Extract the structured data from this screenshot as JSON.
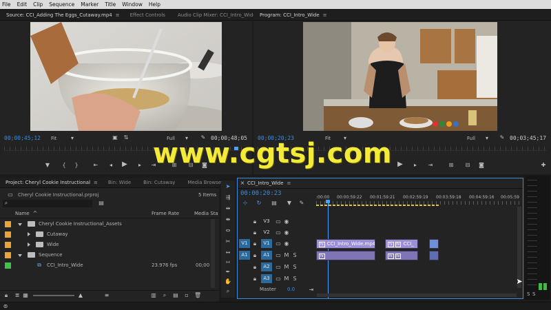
{
  "menu": [
    "File",
    "Edit",
    "Clip",
    "Sequence",
    "Marker",
    "Title",
    "Window",
    "Help"
  ],
  "source": {
    "tabs": [
      "Source: CCI_Adding The Eggs_Cutaway.mp4",
      "Effect Controls",
      "Audio Clip Mixer: CCI_Intro_Wide"
    ],
    "timecode_in": "00;00;45;12",
    "fit": "Fit",
    "resolution": "Full",
    "timecode_out": "00;00;48;05"
  },
  "program": {
    "tab": "Program: CCI_Intro_Wide",
    "timecode_in": "00;00;20;23",
    "fit": "Fit",
    "resolution": "Full",
    "timecode_out": "00;03;45;17"
  },
  "watermark": "www.cgtsj.com",
  "project": {
    "tabs": [
      "Project: Cheryl Cookie Instructional",
      "Bin: Wide",
      "Bin: Cutaway",
      "Media Browse"
    ],
    "file": "Cheryl Cookie Instructional.prproj",
    "items": "5 Items",
    "search_placeholder": "",
    "columns": [
      "Name",
      "Frame Rate",
      "Media Sta"
    ],
    "rows": [
      {
        "name": "Cheryl Cookie Instructional_Assets",
        "rate": "",
        "media": "",
        "color": "#e8a33a"
      },
      {
        "name": "Cutaway",
        "rate": "",
        "media": "",
        "color": "#e8a33a"
      },
      {
        "name": "Wide",
        "rate": "",
        "media": "",
        "color": "#e8a33a"
      },
      {
        "name": "Sequence",
        "rate": "",
        "media": "",
        "color": "#e8a33a"
      },
      {
        "name": "CCI_Intro_Wide",
        "rate": "23.976 fps",
        "media": "00;00",
        "color": "#3fc24a"
      }
    ]
  },
  "timeline": {
    "tab": "CCI_Intro_Wide",
    "timecode": "00:00:20:23",
    "ruler": [
      ":00:00",
      "00:00:59:22",
      "00:01:59:21",
      "00:02:59:19",
      "00:03:59:18",
      "00:04:59:16",
      "00:05:59"
    ],
    "tracks": [
      {
        "name": "V3",
        "src": "",
        "type": "video"
      },
      {
        "name": "V2",
        "src": "",
        "type": "video"
      },
      {
        "name": "V1",
        "src": "V1",
        "type": "video"
      },
      {
        "name": "A1",
        "src": "A1",
        "type": "audio"
      },
      {
        "name": "A2",
        "src": "",
        "type": "audio"
      },
      {
        "name": "A3",
        "src": "",
        "type": "audio"
      }
    ],
    "master_label": "Master",
    "master_value": "0.0",
    "clip1": "CCI_Intro_Wide.mp4",
    "clip2": "CCI_"
  },
  "meter": {
    "s1": "S",
    "s2": "S"
  }
}
